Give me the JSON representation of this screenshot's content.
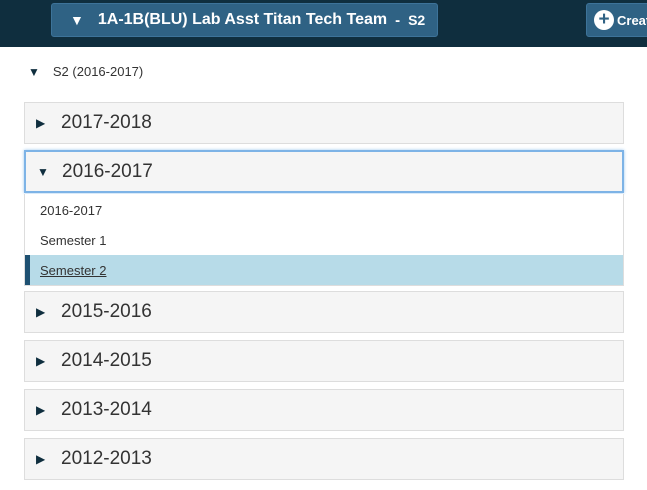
{
  "header": {
    "course_name": "1A-1B(BLU) Lab Asst Titan Tech Team",
    "separator": "-",
    "term": "S2",
    "create_label": "Creat"
  },
  "context": {
    "label": "S2 (2016-2017)"
  },
  "years": [
    {
      "label": "2017-2018",
      "expanded": false
    },
    {
      "label": "2016-2017",
      "expanded": true
    },
    {
      "label": "2015-2016",
      "expanded": false
    },
    {
      "label": "2014-2015",
      "expanded": false
    },
    {
      "label": "2013-2014",
      "expanded": false
    },
    {
      "label": "2012-2013",
      "expanded": false
    }
  ],
  "terms_2016_2017": [
    {
      "label": "2016-2017",
      "selected": false
    },
    {
      "label": "Semester 1",
      "selected": false
    },
    {
      "label": "Semester 2",
      "selected": true
    }
  ],
  "colors": {
    "topbar": "#0f2e3e",
    "button": "#2f6284",
    "selected_bg": "#b7dbe8",
    "selected_bar": "#1e5172",
    "focus_border": "#7db3e6"
  },
  "icons": {
    "collapsed": "triangle-right-icon",
    "expanded": "triangle-down-icon",
    "create": "plus-circle-icon"
  }
}
